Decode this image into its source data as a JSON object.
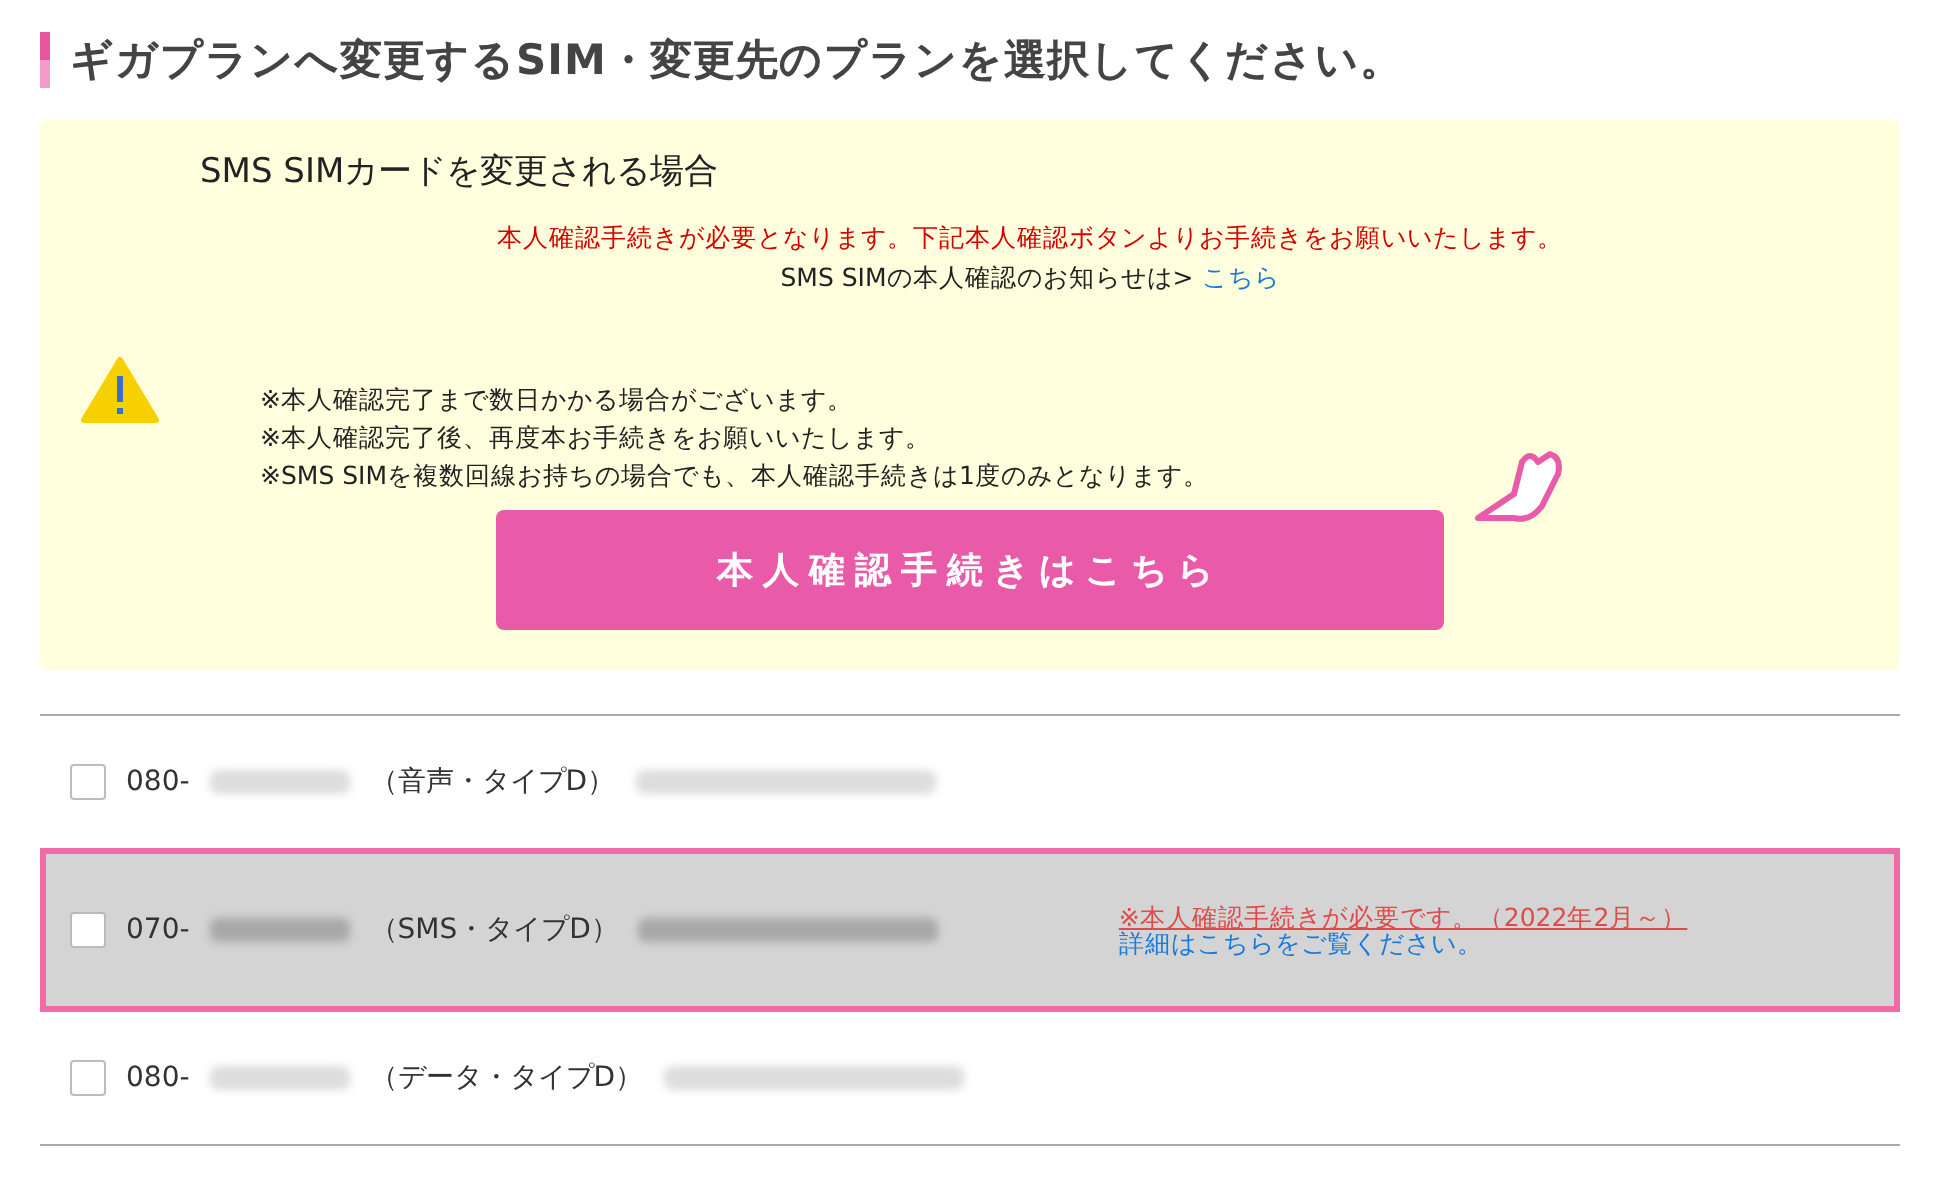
{
  "heading": "ギガプランへ変更するSIM・変更先のプランを選択してください。",
  "notice": {
    "title": "SMS SIMカードを変更される場合",
    "warning": "本人確認手続きが必要となります。下記本人確認ボタンよりお手続きをお願いいたします。",
    "info_text": "SMS SIMの本人確認のお知らせは>",
    "info_link": "こちら",
    "notes": [
      "※本人確認完了まで数日かかる場合がございます。",
      "※本人確認完了後、再度本お手続きをお願いいたします。",
      "※SMS SIMを複数回線お持ちの場合でも、本人確認手続きは1度のみとなります。"
    ],
    "button": "本人確認手続きはこちら"
  },
  "lines": [
    {
      "number": "080-",
      "type": "（音声・タイプD）",
      "checked": false,
      "highlighted": false
    },
    {
      "number": "070-",
      "type": "（SMS・タイプD）",
      "checked": false,
      "highlighted": true,
      "alert": "※本人確認手続きが必要です。（2022年2月～）",
      "link": "詳細はこちらをご覧ください。"
    },
    {
      "number": "080-",
      "type": "（データ・タイプD）",
      "checked": false,
      "highlighted": false
    }
  ]
}
